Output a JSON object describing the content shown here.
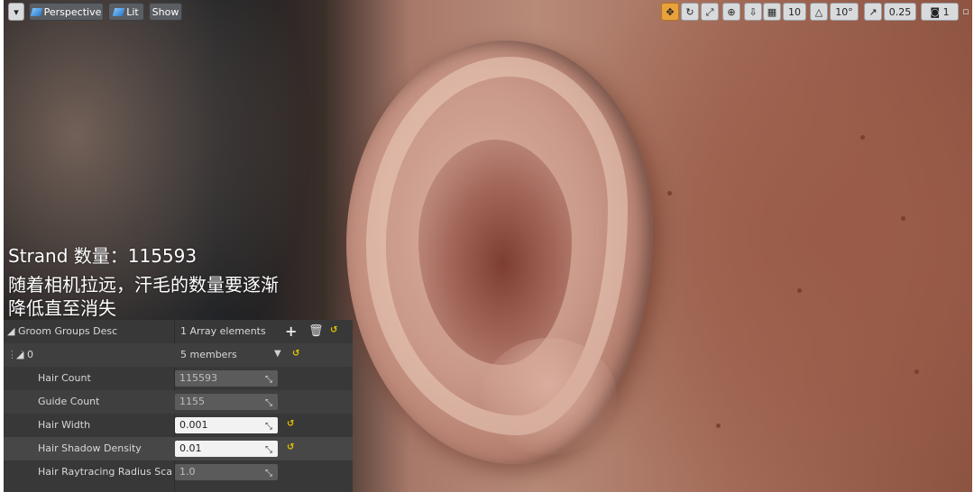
{
  "toolbar_left": {
    "perspective_label": "Perspective",
    "lit_label": "Lit",
    "show_label": "Show"
  },
  "toolbar_right": {
    "grid_snap_value": "10",
    "rotation_snap_value": "10°",
    "scale_snap_value": "0.25",
    "camera_speed_value": "1"
  },
  "overlay": {
    "strand_count": "Strand 数量：115593",
    "note_line1": "随着相机拉远，汗毛的数量要逐渐",
    "note_line2": "降低直至消失"
  },
  "details": {
    "section_label": "Groom Groups Desc",
    "array_count": "1 Array elements",
    "element_index": "0",
    "members_label": "5 members",
    "properties": [
      {
        "label": "Hair Count",
        "value": "115593"
      },
      {
        "label": "Guide Count",
        "value": "1155"
      },
      {
        "label": "Hair Width",
        "value": "0.001"
      },
      {
        "label": "Hair Shadow Density",
        "value": "0.01"
      },
      {
        "label": "Hair Raytracing Radius Scale",
        "value": "1.0"
      }
    ]
  },
  "colors": {
    "panel_bg": "#383838",
    "reset_arrow": "#e8c400",
    "toolbar_accent": "#e9a23b"
  }
}
